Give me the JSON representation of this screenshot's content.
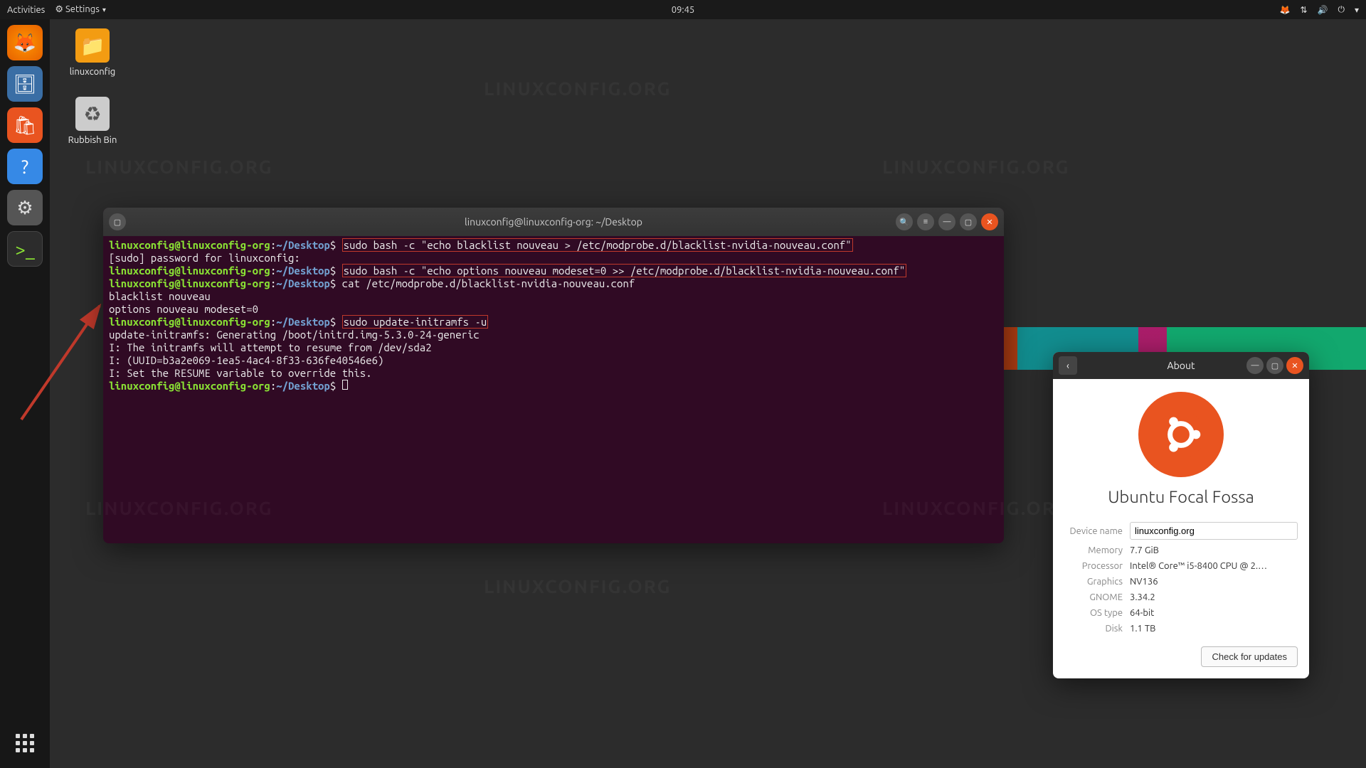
{
  "topbar": {
    "activities": "Activities",
    "app": "Settings",
    "clock": "09:45"
  },
  "dock": {
    "firefox": "firefox-icon",
    "files": "files-icon",
    "software": "software-icon",
    "help": "help-icon",
    "settings": "settings-icon",
    "terminal": "terminal-icon"
  },
  "desktop": {
    "folder": "linuxconfig",
    "trash": "Rubbish Bin"
  },
  "terminal": {
    "title": "linuxconfig@linuxconfig-org: ~/Desktop",
    "prompt_user": "linuxconfig@linuxconfig-org",
    "prompt_path": "~/Desktop",
    "lines": {
      "cmd1": "sudo bash -c \"echo blacklist nouveau > /etc/modprobe.d/blacklist-nvidia-nouveau.conf\"",
      "sudo": "[sudo] password for linuxconfig:",
      "cmd2": "sudo bash -c \"echo options nouveau modeset=0 >> /etc/modprobe.d/blacklist-nvidia-nouveau.conf\"",
      "cmd3": "cat /etc/modprobe.d/blacklist-nvidia-nouveau.conf",
      "out1": "blacklist nouveau",
      "out2": "options nouveau modeset=0",
      "cmd4": "sudo update-initramfs -u",
      "out3": "update-initramfs: Generating /boot/initrd.img-5.3.0-24-generic",
      "out4": "I: The initramfs will attempt to resume from /dev/sda2",
      "out5": "I: (UUID=b3a2e069-1ea5-4ac4-8f33-636fe40546e6)",
      "out6": "I: Set the RESUME variable to override this."
    }
  },
  "about": {
    "title": "About",
    "distro": "Ubuntu Focal Fossa",
    "rows": {
      "device_label": "Device name",
      "device_value": "linuxconfig.org",
      "memory_label": "Memory",
      "memory_value": "7.7 GiB",
      "processor_label": "Processor",
      "processor_value": "Intel® Core™ i5-8400 CPU @ 2.…",
      "graphics_label": "Graphics",
      "graphics_value": "NV136",
      "gnome_label": "GNOME",
      "gnome_value": "3.34.2",
      "ostype_label": "OS type",
      "ostype_value": "64-bit",
      "disk_label": "Disk",
      "disk_value": "1.1 TB"
    },
    "check": "Check for updates"
  },
  "watermark": "LINUXCONFIG.ORG"
}
